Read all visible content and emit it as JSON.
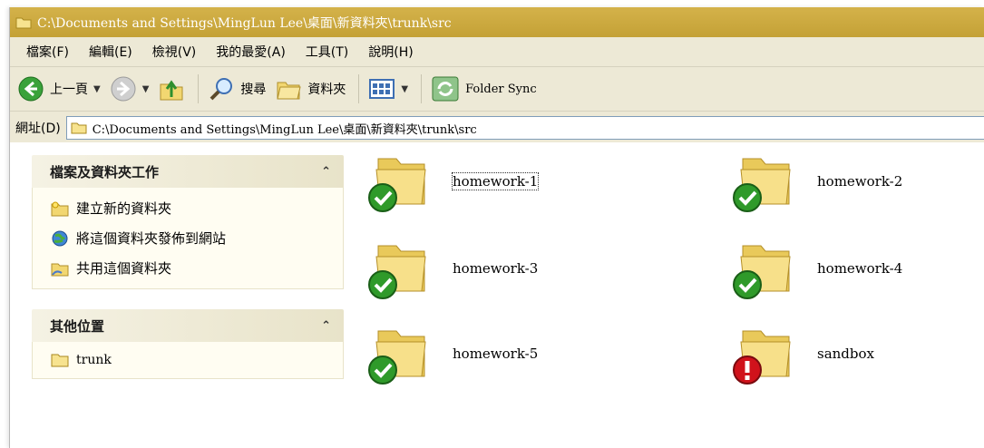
{
  "window": {
    "title": "C:\\Documents and Settings\\MingLun Lee\\桌面\\新資料夾\\trunk\\src"
  },
  "menu": {
    "items": [
      "檔案(F)",
      "編輯(E)",
      "檢視(V)",
      "我的最愛(A)",
      "工具(T)",
      "說明(H)"
    ]
  },
  "toolbar": {
    "back_label": "上一頁",
    "search_label": "搜尋",
    "folders_label": "資料夾",
    "folder_sync_label": "Folder Sync"
  },
  "address": {
    "label": "網址(D)",
    "value": "C:\\Documents and Settings\\MingLun Lee\\桌面\\新資料夾\\trunk\\src"
  },
  "tasks_pane": {
    "title": "檔案及資料夾工作",
    "items": [
      "建立新的資料夾",
      "將這個資料夾發佈到網站",
      "共用這個資料夾"
    ]
  },
  "places_pane": {
    "title": "其他位置",
    "items": [
      "trunk"
    ]
  },
  "folders": [
    {
      "name": "homework-1",
      "status": "ok"
    },
    {
      "name": "homework-2",
      "status": "ok"
    },
    {
      "name": "homework-3",
      "status": "ok"
    },
    {
      "name": "homework-4",
      "status": "ok"
    },
    {
      "name": "homework-5",
      "status": "ok"
    },
    {
      "name": "sandbox",
      "status": "error"
    }
  ],
  "colors": {
    "title_bar": "#c9a73e",
    "chrome": "#ede9d6",
    "ok_badge": "#2f9a2a",
    "error_badge": "#d0121b",
    "folder": "#f2d771"
  }
}
